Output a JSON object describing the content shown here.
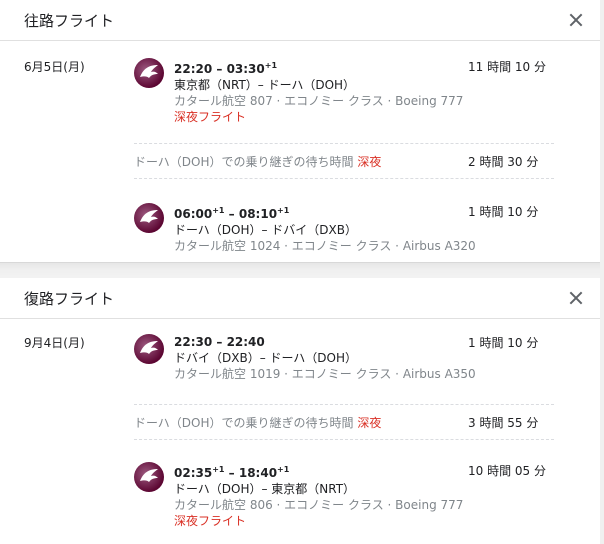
{
  "outbound": {
    "title": "往路フライト",
    "date": "6月5日(月)",
    "leg1": {
      "dep": "22:20",
      "arr": "03:30",
      "arr_plus": "+1",
      "route": "東京都（NRT）– ドーハ（DOH）",
      "meta": "カタール航空 807 · エコノミー クラス · Boeing 777",
      "badge": "深夜フライト",
      "duration": "11 時間 10 分"
    },
    "layover": {
      "text": "ドーハ（DOH）での乗り継ぎの待ち時間",
      "badge": "深夜",
      "duration": "2 時間 30 分"
    },
    "leg2": {
      "dep": "06:00",
      "dep_plus": "+1",
      "arr": "08:10",
      "arr_plus": "+1",
      "route": "ドーハ（DOH）– ドバイ（DXB）",
      "meta": "カタール航空 1024 · エコノミー クラス · Airbus A320",
      "duration": "1 時間 10 分"
    }
  },
  "return": {
    "title": "復路フライト",
    "date": "9月4日(月)",
    "leg1": {
      "dep": "22:30",
      "arr": "22:40",
      "route": "ドバイ（DXB）– ドーハ（DOH）",
      "meta": "カタール航空 1019 · エコノミー クラス · Airbus A350",
      "duration": "1 時間 10 分"
    },
    "layover": {
      "text": "ドーハ（DOH）での乗り継ぎの待ち時間",
      "badge": "深夜",
      "duration": "3 時間 55 分"
    },
    "leg2": {
      "dep": "02:35",
      "dep_plus": "+1",
      "arr": "18:40",
      "arr_plus": "+1",
      "route": "ドーハ（DOH）– 東京都（NRT）",
      "meta": "カタール航空 806 · エコノミー クラス · Boeing 777",
      "badge": "深夜フライト",
      "duration": "10 時間 05 分"
    }
  },
  "icons": {
    "close": "close-icon",
    "airline_logo": "qatar-airways-oryx-logo"
  },
  "colors": {
    "night": "#d93025",
    "logo": "#5c0632",
    "muted": "#80868b"
  }
}
